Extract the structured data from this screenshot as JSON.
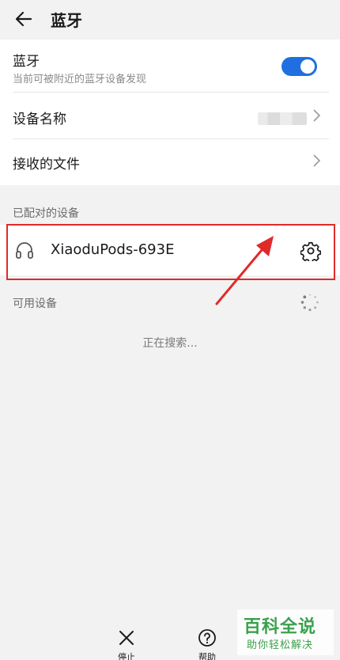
{
  "header": {
    "title": "蓝牙"
  },
  "bluetooth": {
    "label": "蓝牙",
    "subtitle": "当前可被附近的蓝牙设备发现",
    "enabled": true,
    "accent": "#1f6fe0"
  },
  "settings": {
    "device_name_label": "设备名称",
    "received_files_label": "接收的文件"
  },
  "paired": {
    "section_label": "已配对的设备",
    "devices": [
      {
        "name": "XiaoduPods-693E",
        "icon": "headset-icon"
      }
    ]
  },
  "available": {
    "section_label": "可用设备",
    "status": "正在搜索..."
  },
  "bottom": {
    "stop_label": "停止",
    "help_label": "帮助"
  },
  "annotation": {
    "color": "#e02a2a"
  },
  "watermark": {
    "main": "百科全说",
    "sub": "助你轻松解决"
  }
}
